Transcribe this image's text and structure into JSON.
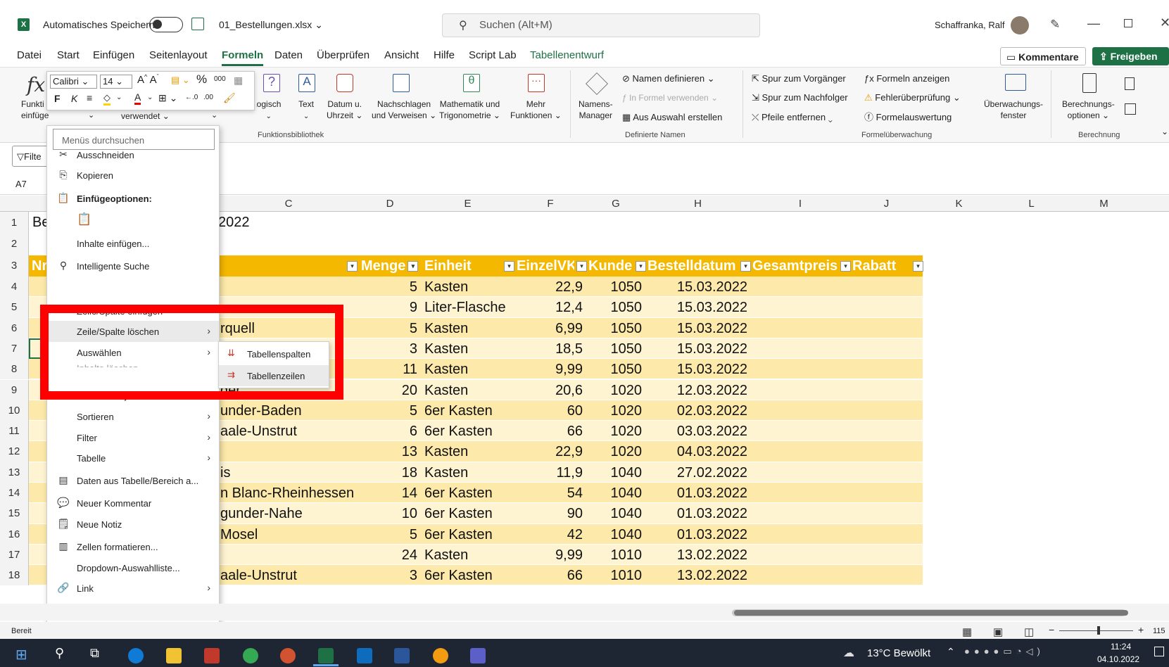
{
  "window": {
    "autosave_label": "Automatisches Speichern",
    "filename": "01_Bestellungen.xlsx",
    "search_placeholder": "Suchen (Alt+M)",
    "user": "Schaffranka, Ralf"
  },
  "menu": {
    "tabs": [
      "Datei",
      "Start",
      "Einfügen",
      "Seitenlayout",
      "Formeln",
      "Daten",
      "Überprüfen",
      "Ansicht",
      "Hilfe",
      "Script Lab",
      "Tabellenentwurf"
    ],
    "active_tab": "Formeln",
    "comments_label": "Kommentare",
    "share_label": "Freigeben"
  },
  "ribbon": {
    "insert_function": "Funkti einfügen",
    "used_label": "verwendet",
    "logical": "Logisch",
    "text": "Text",
    "datetime_1": "Datum u.",
    "datetime_2": "Uhrzeit",
    "lookup_1": "Nachschlagen",
    "lookup_2": "und Verweisen",
    "math_1": "Mathematik und",
    "math_2": "Trigonometrie",
    "more_1": "Mehr",
    "more_2": "Funktionen",
    "library_group": "Funktionsbibliothek",
    "name_manager_1": "Namens-",
    "name_manager_2": "Manager",
    "define_name": "Namen definieren",
    "use_in_formula": "In Formel verwenden",
    "create_from_selection": "Aus Auswahl erstellen",
    "names_group": "Definierte Namen",
    "trace_precedents": "Spur zum Vorgänger",
    "trace_dependents": "Spur zum Nachfolger",
    "remove_arrows": "Pfeile entfernen",
    "show_formulas": "Formeln anzeigen",
    "error_checking": "Fehlerüberprüfung",
    "evaluate_formula": "Formelauswertung",
    "watch_1": "Überwachungs-",
    "watch_2": "fenster",
    "audit_group": "Formelüberwachung",
    "calc_1": "Berechnungs-",
    "calc_2": "optionen",
    "calc_group": "Berechnung",
    "filter_label": "Filte"
  },
  "minibar": {
    "font": "Calibri",
    "size": "14",
    "bold": "F",
    "italic": "K",
    "percent": "%",
    "thousands": "000"
  },
  "namebox": "A7",
  "context_menu": {
    "search": "Menüs durchsuchen",
    "items": [
      {
        "label": "Ausschneiden",
        "icon": "✂"
      },
      {
        "label": "Kopieren",
        "icon": "⎘"
      },
      {
        "label": "Einfügeoptionen:",
        "icon": "📋"
      },
      {
        "label": "Inhalte einfügen...",
        "icon": ""
      },
      {
        "label": "Intelligente Suche",
        "icon": "⚲"
      },
      {
        "label": "Zeile/Spalte einfügen",
        "icon": ""
      },
      {
        "label": "Zeile/Spalte löschen",
        "icon": ""
      },
      {
        "label": "Auswählen",
        "icon": ""
      },
      {
        "label": "Inhalte löschen",
        "icon": ""
      },
      {
        "label": "Schnellanalyse",
        "icon": "▦"
      },
      {
        "label": "Sortieren",
        "icon": ""
      },
      {
        "label": "Filter",
        "icon": ""
      },
      {
        "label": "Tabelle",
        "icon": ""
      },
      {
        "label": "Daten aus Tabelle/Bereich a...",
        "icon": "▤"
      },
      {
        "label": "Neuer Kommentar",
        "icon": "💬"
      },
      {
        "label": "Neue Notiz",
        "icon": "🗒"
      },
      {
        "label": "Zellen formatieren...",
        "icon": "▥"
      },
      {
        "label": "Dropdown-Auswahlliste...",
        "icon": ""
      },
      {
        "label": "Link",
        "icon": "🔗"
      }
    ]
  },
  "submenu": {
    "items": [
      "Tabellenspalten",
      "Tabellenzeilen"
    ]
  },
  "sheet": {
    "columns": [
      "C",
      "D",
      "E",
      "F",
      "G",
      "H",
      "I",
      "J",
      "K",
      "L",
      "M"
    ],
    "title_left": "Be",
    "title_right": "2022",
    "header_left": "Nr",
    "headers": {
      "menge": "Menge",
      "einheit": "Einheit",
      "einzelvk": "EinzelVK",
      "kunde": "Kunde",
      "bestelldatum": "Bestelldatum",
      "gesamtpreis": "Gesamtpreis",
      "rabatt": "Rabatt"
    },
    "rows": [
      {
        "row": "4",
        "c": "",
        "menge": "5",
        "einheit": "Kasten",
        "vk": "22,9",
        "kunde": "1050",
        "datum": "15.03.2022"
      },
      {
        "row": "5",
        "c": "",
        "menge": "9",
        "einheit": "Liter-Flasche",
        "vk": "12,4",
        "kunde": "1050",
        "datum": "15.03.2022"
      },
      {
        "row": "6",
        "c": "rquell",
        "menge": "5",
        "einheit": "Kasten",
        "vk": "6,99",
        "kunde": "1050",
        "datum": "15.03.2022"
      },
      {
        "row": "7",
        "c": "",
        "menge": "3",
        "einheit": "Kasten",
        "vk": "18,5",
        "kunde": "1050",
        "datum": "15.03.2022"
      },
      {
        "row": "8",
        "c": "",
        "menge": "11",
        "einheit": "Kasten",
        "vk": "9,99",
        "kunde": "1050",
        "datum": "15.03.2022"
      },
      {
        "row": "9",
        "c": "der",
        "menge": "20",
        "einheit": "Kasten",
        "vk": "20,6",
        "kunde": "1020",
        "datum": "12.03.2022"
      },
      {
        "row": "10",
        "c": "under-Baden",
        "menge": "5",
        "einheit": "6er Kasten",
        "vk": "60",
        "kunde": "1020",
        "datum": "02.03.2022"
      },
      {
        "row": "11",
        "c": "aale-Unstrut",
        "menge": "6",
        "einheit": "6er Kasten",
        "vk": "66",
        "kunde": "1020",
        "datum": "03.03.2022"
      },
      {
        "row": "12",
        "c": "",
        "menge": "13",
        "einheit": "Kasten",
        "vk": "22,9",
        "kunde": "1020",
        "datum": "04.03.2022"
      },
      {
        "row": "13",
        "c": "is",
        "menge": "18",
        "einheit": "Kasten",
        "vk": "11,9",
        "kunde": "1040",
        "datum": "27.02.2022"
      },
      {
        "row": "14",
        "c": "n Blanc-Rheinhessen",
        "menge": "14",
        "einheit": "6er Kasten",
        "vk": "54",
        "kunde": "1040",
        "datum": "01.03.2022"
      },
      {
        "row": "15",
        "c": "gunder-Nahe",
        "menge": "10",
        "einheit": "6er Kasten",
        "vk": "90",
        "kunde": "1040",
        "datum": "01.03.2022"
      },
      {
        "row": "16",
        "c": "Mosel",
        "menge": "5",
        "einheit": "6er Kasten",
        "vk": "42",
        "kunde": "1040",
        "datum": "01.03.2022"
      },
      {
        "row": "17",
        "c": "",
        "menge": "24",
        "einheit": "Kasten",
        "vk": "9,99",
        "kunde": "1010",
        "datum": "13.02.2022"
      },
      {
        "row": "18",
        "c": "aale-Unstrut",
        "menge": "3",
        "einheit": "6er Kasten",
        "vk": "66",
        "kunde": "1010",
        "datum": "13.02.2022"
      }
    ]
  },
  "status": {
    "ready": "Bereit",
    "zoom": "115"
  },
  "taskbar": {
    "weather": "13°C Bewölkt",
    "time": "11:24",
    "date": "04.10.2022"
  },
  "colors": {
    "table_header": "#f5b800",
    "band_dark": "#fde9a9",
    "band_light": "#fff4d2",
    "excel_green": "#1e7145",
    "highlight_red": "#ff0000"
  }
}
